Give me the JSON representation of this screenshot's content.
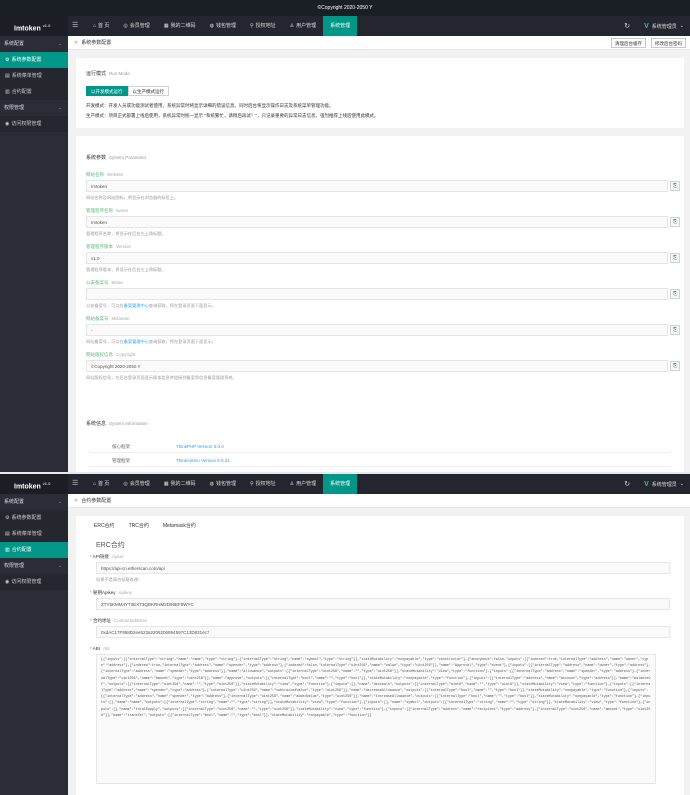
{
  "panel1": {
    "copyright": "©Copyright 2020-2050 Y",
    "topbar": {
      "brand": "Imtoken",
      "brand_version": "v1.0",
      "menu_icon": "hamburger-icon",
      "nav": [
        {
          "label": "首 页",
          "icon": "home-icon",
          "active": false
        },
        {
          "label": "会员管理",
          "icon": "user-icon",
          "active": false
        },
        {
          "label": "我的二维码",
          "icon": "qrcode-icon",
          "active": false
        },
        {
          "label": "钱包管理",
          "icon": "wallet-icon",
          "active": false
        },
        {
          "label": "授权地址",
          "icon": "location-icon",
          "active": false
        },
        {
          "label": "用户管理",
          "icon": "person-icon",
          "active": false
        },
        {
          "label": "系统管理",
          "icon": "",
          "active": true
        }
      ],
      "user_label": "系统管理员"
    },
    "sidebar": {
      "groups": [
        {
          "label": "系统配置",
          "items": [
            {
              "label": "系统参数配置",
              "active": true
            },
            {
              "label": "系统菜单管理",
              "active": false
            },
            {
              "label": "合约配置",
              "active": false
            }
          ]
        },
        {
          "label": "权限管理",
          "items": [
            {
              "label": "访问权限管理",
              "active": false
            }
          ]
        }
      ]
    },
    "breadcrumb": "系统参数配置",
    "header_buttons": [
      "清理后台缓存",
      "修改后台密码"
    ],
    "run_mode": {
      "title": "运行模式",
      "title_en": "Run Mode",
      "options": [
        "以开发模式运行",
        "以生产模式运行"
      ],
      "notes": [
        "开发模式：开发人员或功能测试者使用，系统异常时将显示详细的错误信息，同时后台将显示操作日志及系统菜单管理功能。",
        "生产模式：项目正式部署上线后使用，系统异常时统一显示 \"系统繁忙，请稍后再试！\"，只记录重要的异常日志信息，强烈推荐上线后使用此模式。"
      ]
    },
    "params": {
      "title": "系统参数",
      "title_en": "System Parameter",
      "fields": [
        {
          "label": "网站名称",
          "en": "Website",
          "value": "Imtoken",
          "help": "网站名称及网站图标，将显示在浏览器的标签上。"
        },
        {
          "label": "管理程序名称",
          "en": "Name",
          "value": "Imtoken",
          "help": "管理程序名称，将显示在后台左上角标题。"
        },
        {
          "label": "管理程序版本",
          "en": "Version",
          "value": "v1.0",
          "help": "管理程序版本，将显示在后台左上角标题。"
        },
        {
          "label": "公安备案号",
          "en": "Beian",
          "value": "",
          "help_pre": "公安备案号，可以在",
          "help_link": "备案管理中心",
          "help_post": "查询获取，将在登录页面下面显示。"
        },
        {
          "label": "网站备案号",
          "en": "Miitbeian",
          "value": "-",
          "help_pre": "网站备案号，可以在",
          "help_link": "备案管理中心",
          "help_post": "查询获取，将在登录页面下面显示。"
        },
        {
          "label": "网站版权信息",
          "en": "Copyright",
          "value": "©Copyright 2020-2050 Y",
          "help": "网站版权信息，在后台登录页面显示版本信息并链接到备案到信息备案管理系统。"
        }
      ],
      "field_button_icon": "copy-icon"
    },
    "sysinfo": {
      "title": "系统信息",
      "title_en": "System Information",
      "rows": [
        {
          "k": "核心框架",
          "v": "ThinkPHP Version 6.0.0"
        },
        {
          "k": "管理框架",
          "v": "ThinkAdmin Version 6.0.21"
        }
      ]
    }
  },
  "panel2": {
    "topbar": {
      "brand": "Imtoken",
      "brand_version": "v1.0",
      "nav": [
        {
          "label": "首 页",
          "icon": "home-icon",
          "active": false
        },
        {
          "label": "会员管理",
          "icon": "user-icon",
          "active": false
        },
        {
          "label": "我的二维码",
          "icon": "qrcode-icon",
          "active": false
        },
        {
          "label": "钱包管理",
          "icon": "wallet-icon",
          "active": false
        },
        {
          "label": "授权地址",
          "icon": "location-icon",
          "active": false
        },
        {
          "label": "用户管理",
          "icon": "person-icon",
          "active": false
        },
        {
          "label": "系统管理",
          "icon": "",
          "active": true
        }
      ],
      "user_label": "系统管理员"
    },
    "sidebar": {
      "groups": [
        {
          "label": "系统配置",
          "items": [
            {
              "label": "系统参数配置",
              "active": false
            },
            {
              "label": "系统菜单管理",
              "active": false
            },
            {
              "label": "合约配置",
              "active": true
            }
          ]
        },
        {
          "label": "权限管理",
          "items": [
            {
              "label": "访问权限管理",
              "active": false
            }
          ]
        }
      ]
    },
    "breadcrumb": "合约参数配置",
    "tabs": [
      "ERC合约",
      "TRC合约",
      "Metamask合约"
    ],
    "section_title": "ERC合约",
    "fields": [
      {
        "label": "API链接",
        "en": "Apiurl",
        "value": "https://api-cn.etherscan.com/api",
        "help": "如果不是请勿轻易修改！"
      },
      {
        "label": "秘钥Apikey",
        "en": "Apikey",
        "value": "ZTY5KMM4YT3EXT3QBKRHM2D99EF8WYC"
      },
      {
        "label": "合约地址",
        "en": "Contractaddress",
        "value": "0xdAC17F958D2ee523a2206206994597C13D831ec7"
      },
      {
        "label": "ABI",
        "en": "Abi",
        "value": "[{\"inputs\":[{\"internalType\":\"string\",\"name\":\"name\",\"type\":\"string\"},{\"internalType\":\"string\",\"name\":\"symbol\",\"type\":\"string\"}],\"stateMutability\":\"nonpayable\",\"type\":\"constructor\"},{\"anonymous\":false,\"inputs\":[{\"indexed\":true,\"internalType\":\"address\",\"name\":\"owner\",\"type\":\"address\"},{\"indexed\":true,\"internalType\":\"address\",\"name\":\"spender\",\"type\":\"address\"},{\"indexed\":false,\"internalType\":\"uint256\",\"name\":\"value\",\"type\":\"uint256\"}],\"name\":\"Approval\",\"type\":\"event\"},{\"inputs\":[{\"internalType\":\"address\",\"name\":\"owner\",\"type\":\"address\"},{\"internalType\":\"address\",\"name\":\"spender\",\"type\":\"address\"}],\"name\":\"allowance\",\"outputs\":[{\"internalType\":\"uint256\",\"name\":\"\",\"type\":\"uint256\"}],\"stateMutability\":\"view\",\"type\":\"function\"},{\"inputs\":[{\"internalType\":\"address\",\"name\":\"spender\",\"type\":\"address\"},{\"internalType\":\"uint256\",\"name\":\"amount\",\"type\":\"uint256\"}],\"name\":\"approve\",\"outputs\":[{\"internalType\":\"bool\",\"name\":\"\",\"type\":\"bool\"}],\"stateMutability\":\"nonpayable\",\"type\":\"function\"},{\"inputs\":[{\"internalType\":\"address\",\"name\":\"account\",\"type\":\"address\"}],\"name\":\"balanceOf\",\"outputs\":[{\"internalType\":\"uint256\",\"name\":\"\",\"type\":\"uint256\"}],\"stateMutability\":\"view\",\"type\":\"function\"},{\"inputs\":[],\"name\":\"decimals\",\"outputs\":[{\"internalType\":\"uint8\",\"name\":\"\",\"type\":\"uint8\"}],\"stateMutability\":\"view\",\"type\":\"function\"},{\"inputs\":[{\"internalType\":\"address\",\"name\":\"spender\",\"type\":\"address\"},{\"internalType\":\"uint256\",\"name\":\"subtractedValue\",\"type\":\"uint256\"}],\"name\":\"decreaseAllowance\",\"outputs\":[{\"internalType\":\"bool\",\"name\":\"\",\"type\":\"bool\"}],\"stateMutability\":\"nonpayable\",\"type\":\"function\"},{\"inputs\":[{\"internalType\":\"address\",\"name\":\"spender\",\"type\":\"address\"},{\"internalType\":\"uint256\",\"name\":\"addedValue\",\"type\":\"uint256\"}],\"name\":\"increaseAllowance\",\"outputs\":[{\"internalType\":\"bool\",\"name\":\"\",\"type\":\"bool\"}],\"stateMutability\":\"nonpayable\",\"type\":\"function\"},{\"inputs\":[],\"name\":\"name\",\"outputs\":[{\"internalType\":\"string\",\"name\":\"\",\"type\":\"string\"}],\"stateMutability\":\"view\",\"type\":\"function\"},{\"inputs\":[],\"name\":\"symbol\",\"outputs\":[{\"internalType\":\"string\",\"name\":\"\",\"type\":\"string\"}],\"stateMutability\":\"view\",\"type\":\"function\"},{\"inputs\":[],\"name\":\"totalSupply\",\"outputs\":[{\"internalType\":\"uint256\",\"name\":\"\",\"type\":\"uint256\"}],\"stateMutability\":\"view\",\"type\":\"function\"},{\"inputs\":[{\"internalType\":\"address\",\"name\":\"recipient\",\"type\":\"address\"},{\"internalType\":\"uint256\",\"name\":\"amount\",\"type\":\"uint256\"}],\"name\":\"transfer\",\"outputs\":[{\"internalType\":\"bool\",\"name\":\"\",\"type\":\"bool\"}],\"stateMutability\":\"nonpayable\",\"type\":\"function\"}]"
      }
    ]
  },
  "colors": {
    "accent": "#009688",
    "topbar": "#23262e",
    "sidebar": "#2a2d35",
    "link": "#1e9fff",
    "label_green": "#5fb878"
  }
}
